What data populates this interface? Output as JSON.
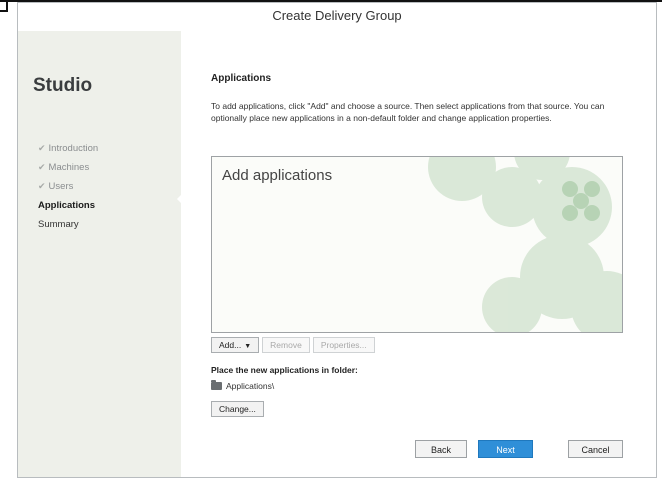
{
  "window": {
    "title": "Create Delivery Group"
  },
  "sidebar": {
    "brand": "Studio",
    "steps": [
      {
        "label": "Introduction",
        "state": "completed"
      },
      {
        "label": "Machines",
        "state": "completed"
      },
      {
        "label": "Users",
        "state": "completed"
      },
      {
        "label": "Applications",
        "state": "active"
      },
      {
        "label": "Summary",
        "state": "pending"
      }
    ],
    "check_glyph": "✔"
  },
  "main": {
    "title": "Applications",
    "description": "To add applications, click \"Add\" and choose a source. Then select applications from that source. You can optionally place new applications in a non-default folder and change application properties.",
    "apps_list": {
      "empty_text": "Add applications"
    },
    "buttons": {
      "add": "Add...",
      "remove": "Remove",
      "properties": "Properties..."
    },
    "folder": {
      "label": "Place the new applications in folder:",
      "path": "Applications\\",
      "change": "Change..."
    }
  },
  "footer": {
    "back": "Back",
    "next": "Next",
    "cancel": "Cancel"
  },
  "colors": {
    "primary_button": "#2f8fd8",
    "watermark": "#a7c9a4"
  }
}
